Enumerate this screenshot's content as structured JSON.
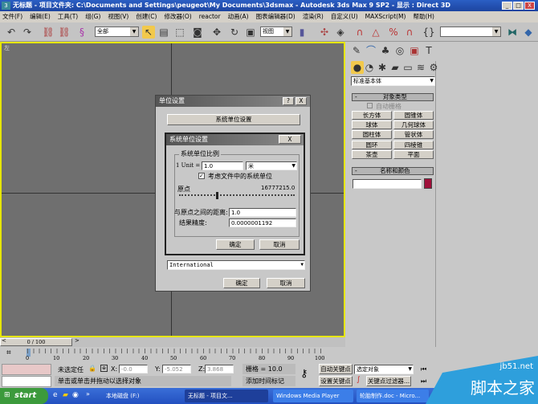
{
  "window": {
    "title": "无标题   - 项目文件夹: C:\\Documents and Settings\\peugeot\\My Documents\\3dsmax    - Autodesk 3ds Max 9 SP2    - 显示 : Direct 3D",
    "minimize": "_",
    "maximize": "□",
    "close": "X"
  },
  "menu": [
    "文件(F)",
    "编辑(E)",
    "工具(T)",
    "组(G)",
    "视图(V)",
    "创建(C)",
    "修改器(O)",
    "reactor",
    "动画(A)",
    "图表编辑器(D)",
    "渲染(R)",
    "自定义(U)",
    "MAXScript(M)",
    "帮助(H)"
  ],
  "toolbar": {
    "selection_filter": "全部",
    "coord_system": "视图",
    "named_selection": ""
  },
  "viewport": {
    "label": "左"
  },
  "units_dialog": {
    "title": "单位设置",
    "help": "?",
    "close": "X",
    "system_button": "系统单位设置",
    "display_select": "International",
    "ok": "确定",
    "cancel": "取消"
  },
  "system_dialog": {
    "title": "系统单位设置",
    "close": "X",
    "group": "系统单位比例",
    "unit_label": "1 Unit =",
    "unit_value": "1.0",
    "unit_type": "米",
    "respect_label": "考虑文件中的系统单位",
    "respect_checked": true,
    "origin_label": "原点",
    "origin_value": "16777215.0",
    "distance_label": "与原点之间的距离:",
    "distance_value": "1.0",
    "precision_label": "结果精度:",
    "precision_value": "0.0000001192",
    "ok": "确定",
    "cancel": "取消"
  },
  "cmdpanel": {
    "category": "标准基本体",
    "object_type_header": "对象类型",
    "autogrid": "自动栅格",
    "objects": [
      "长方体",
      "圆锥体",
      "球体",
      "几何球体",
      "圆柱体",
      "管状体",
      "圆环",
      "四棱锥",
      "茶壶",
      "平面"
    ],
    "name_color_header": "名称和颜色",
    "name_value": "",
    "color": "#a0103a"
  },
  "timeline": {
    "frame": "0 / 100",
    "ticks": [
      "0",
      "10",
      "20",
      "30",
      "40",
      "50",
      "60",
      "70",
      "80",
      "90",
      "100"
    ]
  },
  "status": {
    "selection": "未选定任",
    "x_label": "X:",
    "x": "-0.0",
    "y_label": "Y:",
    "y": "-5.052",
    "z_label": "Z:",
    "z": "3.868",
    "grid": "栅格 = 10.0",
    "prompt": "单击或单击并拖动以选择对象",
    "add_time_tag": "添加时间标记",
    "auto_key": "自动关键点",
    "set_key": "设置关键点",
    "key_mode": "选定对象",
    "key_filters": "关键点过滤器..."
  },
  "taskbar": {
    "start": "start",
    "items": [
      "本地磁盘 (F:)",
      "无标题  - 项目文...",
      "Windows Media Player",
      "轮胎制作.doc - Micro..."
    ]
  },
  "watermark": {
    "site": "jb51.net",
    "name": "脚本之家"
  }
}
